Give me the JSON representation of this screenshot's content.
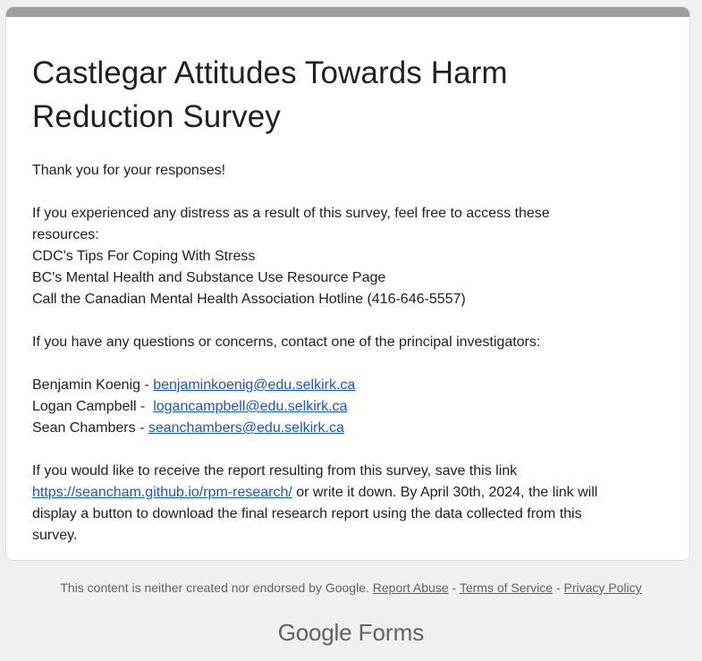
{
  "form": {
    "title_line1": "Castlegar Attitudes Towards Harm",
    "title_line2": "Reduction Survey",
    "thanks": "Thank you for your responses!",
    "distress_intro_1": "If you experienced any distress as a result of this survey, feel free to access these",
    "distress_intro_2": "resources:",
    "resource_1": "CDC's Tips For Coping With Stress",
    "resource_2": "BC's Mental Health and Substance Use Resource Page",
    "resource_3": "Call the Canadian Mental Health Association Hotline (416-646-5557)",
    "questions_intro": "If you have any questions or concerns, contact one of the principal investigators:",
    "investigators": [
      {
        "name": "Benjamin Koenig - ",
        "email": "benjaminkoenig@edu.selkirk.ca"
      },
      {
        "name": "Logan Campbell -  ",
        "email": "logancampbell@edu.selkirk.ca"
      },
      {
        "name": "Sean Chambers - ",
        "email": "seanchambers@edu.selkirk.ca"
      }
    ],
    "report_line1": "If you would like to receive the report resulting from this survey, save this link",
    "report_link": "https://seancham.github.io/rpm-research/",
    "report_after_link": " or write it down. By April 30th, 2024, the link will",
    "report_line3": "display a button to download the final research report using the data collected from this",
    "report_line4": "survey."
  },
  "footer": {
    "disclaimer": "This content is neither created nor endorsed by Google.",
    "report_abuse": "Report Abuse",
    "sep": " - ",
    "terms": "Terms of Service",
    "privacy": "Privacy Policy",
    "brand_google": "Google",
    "brand_forms": "Forms"
  },
  "colors": {
    "header_bar": "#9e9e9e",
    "link": "#1a57c8",
    "page_bg": "#f0f0f0"
  }
}
